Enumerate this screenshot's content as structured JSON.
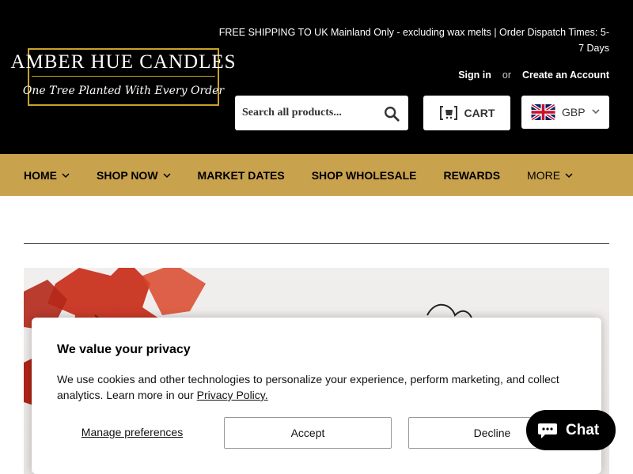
{
  "brand": {
    "name": "AMBER HUE CANDLES",
    "tagline": "One Tree Planted With Every Order"
  },
  "announcement": "FREE SHIPPING TO UK Mainland Only - excluding wax melts | Order Dispatch Times: 5-7 Days",
  "account": {
    "sign_in": "Sign in",
    "or": "or",
    "create": "Create an Account"
  },
  "search": {
    "placeholder": "Search all products...",
    "icon": "search-icon"
  },
  "cart": {
    "label": "CART",
    "icon": "cart-icon"
  },
  "currency": {
    "code": "GBP",
    "flag": "uk-flag-icon"
  },
  "nav": {
    "items": [
      {
        "label": "HOME",
        "has_dropdown": true
      },
      {
        "label": "SHOP NOW",
        "has_dropdown": true
      },
      {
        "label": "MARKET DATES",
        "has_dropdown": false
      },
      {
        "label": "SHOP WHOLESALE",
        "has_dropdown": false
      },
      {
        "label": "REWARDS",
        "has_dropdown": false
      },
      {
        "label": "MORE",
        "has_dropdown": true
      }
    ]
  },
  "cookie": {
    "title": "We value your privacy",
    "text": "We use cookies and other technologies to personalize your experience, perform marketing, and collect analytics. Learn more in our",
    "link": "Privacy Policy.",
    "manage": "Manage preferences",
    "accept": "Accept",
    "decline": "Decline"
  },
  "chat": {
    "label": "Shopify Chat",
    "icon": "chat-bubble-icon"
  },
  "colors": {
    "header_bg": "#000000",
    "nav_bg": "#c9a24e",
    "logo_border": "#c9a227",
    "chat_bg": "#000000"
  }
}
